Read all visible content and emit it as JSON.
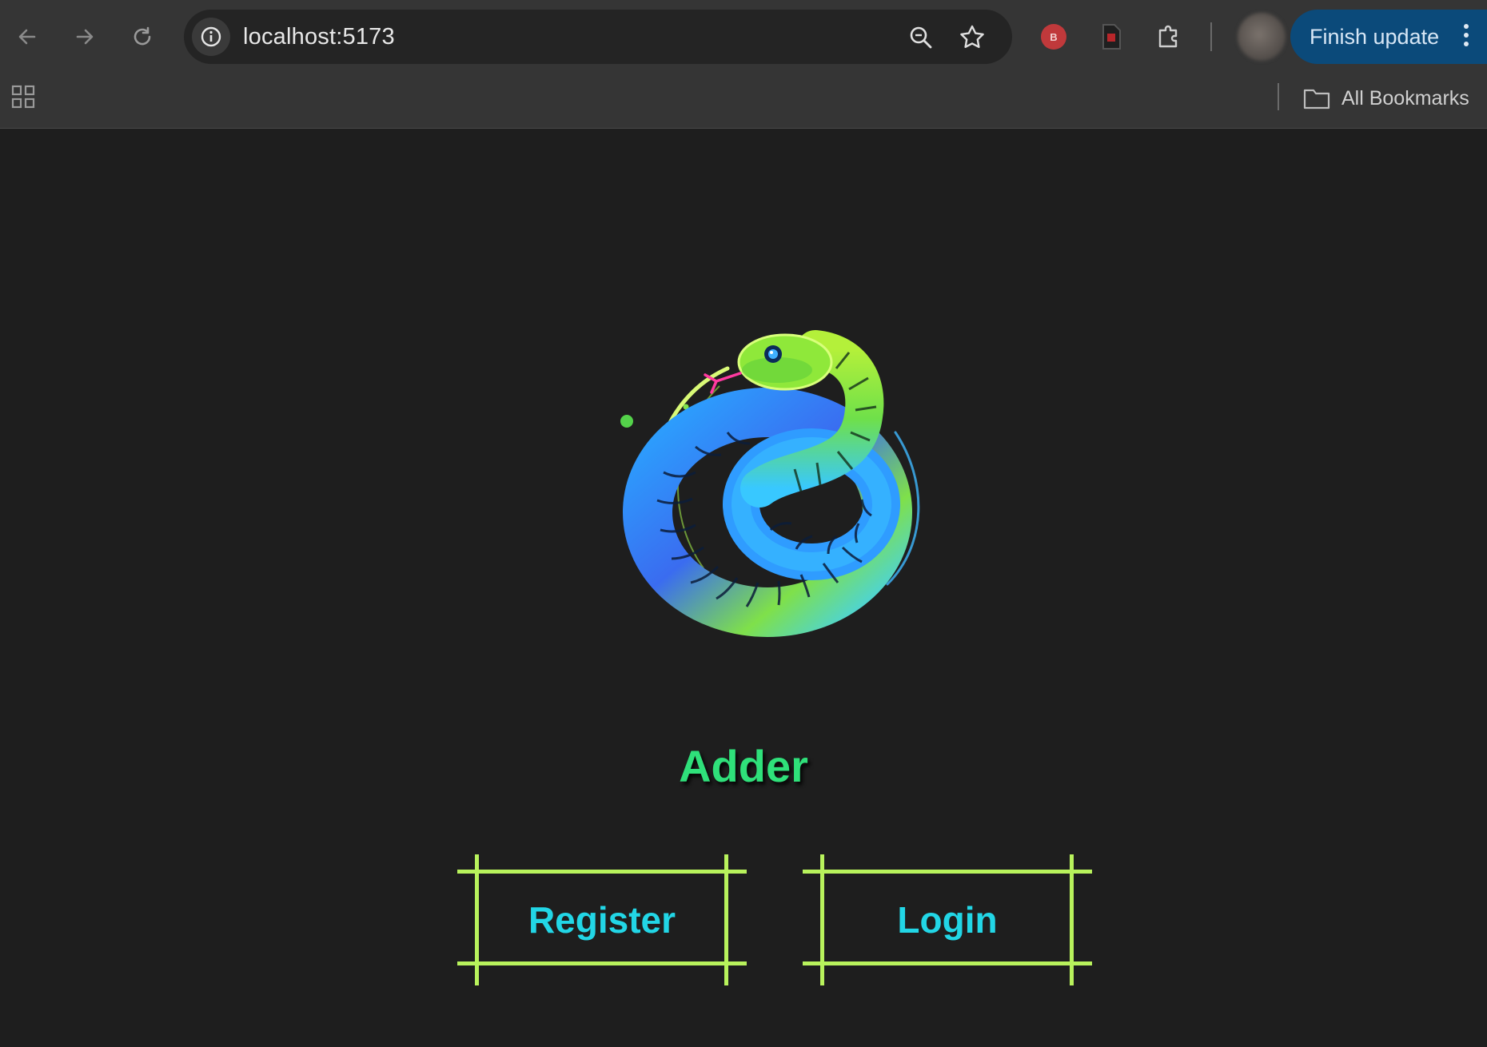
{
  "browser": {
    "url": "localhost:5173",
    "finish_update_label": "Finish update",
    "all_bookmarks_label": "All Bookmarks"
  },
  "app": {
    "title": "Adder",
    "register_label": "Register",
    "login_label": "Login"
  },
  "colors": {
    "page_background": "#1e1e1e",
    "title_green": "#2fe07a",
    "button_border": "#b8f25c",
    "button_text": "#22d6e6",
    "update_button": "#0b4a7a"
  }
}
